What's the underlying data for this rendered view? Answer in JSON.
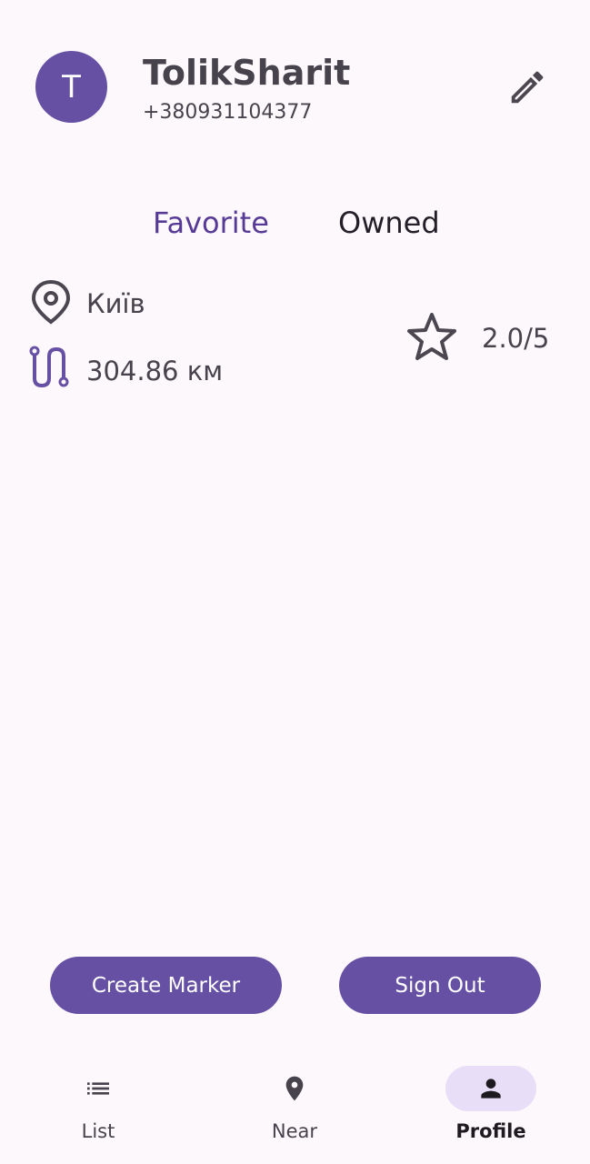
{
  "profile": {
    "avatar_initial": "T",
    "username": "TolikSharit",
    "phone": "+380931104377"
  },
  "tabs": [
    {
      "label": "Favorite",
      "selected": true
    },
    {
      "label": "Owned",
      "selected": false
    }
  ],
  "favorite_item": {
    "location": "Київ",
    "distance": "304.86 км",
    "rating": "2.0/5"
  },
  "buttons": {
    "create_marker": "Create Marker",
    "sign_out": "Sign Out"
  },
  "bottom_nav": [
    {
      "label": "List",
      "icon": "list-icon"
    },
    {
      "label": "Near",
      "icon": "location-pin-icon"
    },
    {
      "label": "Profile",
      "icon": "person-icon",
      "selected": true
    }
  ],
  "colors": {
    "primary": "#6650a4",
    "background": "#fdf8fc",
    "selected_tab": "#563a96",
    "nav_indicator": "#e8def8"
  }
}
